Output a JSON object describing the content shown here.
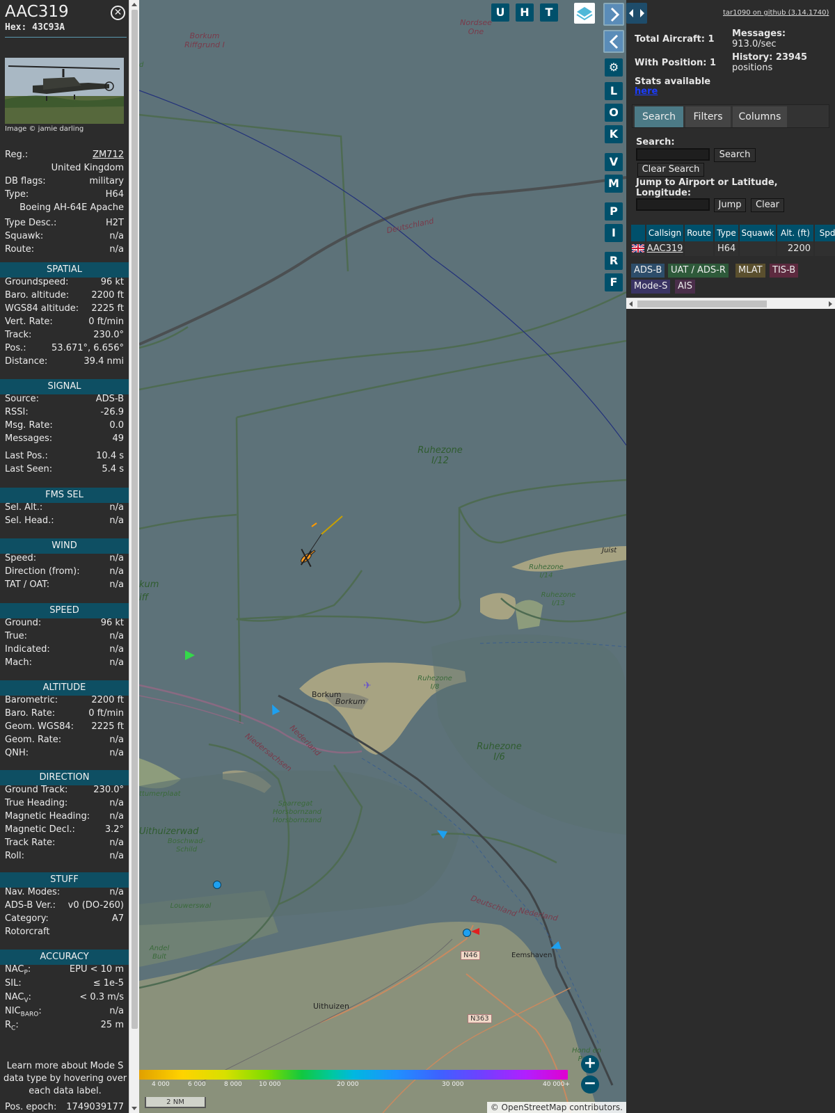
{
  "aircraft": {
    "callsign": "AAC319",
    "hex_label": "Hex: 43C93A",
    "photo_credit": "Image © jamie darling",
    "rows_top": [
      {
        "k": "Reg.:",
        "v": "ZM712"
      },
      {
        "k": "",
        "v": "United Kingdom"
      },
      {
        "k": "DB flags:",
        "v": "military"
      },
      {
        "k": "Type:",
        "v": "H64"
      },
      {
        "k": "",
        "v": "Boeing AH-64E Apache"
      },
      {
        "k": "Type Desc.:",
        "v": "H2T"
      },
      {
        "k": "Squawk:",
        "v": "n/a"
      },
      {
        "k": "Route:",
        "v": "n/a"
      }
    ]
  },
  "sections": {
    "spatial": {
      "title": "SPATIAL",
      "rows": [
        {
          "k": "Groundspeed:",
          "v": "96 kt"
        },
        {
          "k": "Baro. altitude:",
          "v": "2200 ft"
        },
        {
          "k": "WGS84 altitude:",
          "v": "2225 ft"
        },
        {
          "k": "Vert. Rate:",
          "v": "0 ft/min"
        },
        {
          "k": "Track:",
          "v": "230.0°"
        },
        {
          "k": "Pos.:",
          "v": "53.671°, 6.656°"
        },
        {
          "k": "Distance:",
          "v": "39.4 nmi"
        }
      ]
    },
    "signal": {
      "title": "SIGNAL",
      "rows": [
        {
          "k": "Source:",
          "v": "ADS-B"
        },
        {
          "k": "RSSI:",
          "v": "-26.9"
        },
        {
          "k": "Msg. Rate:",
          "v": "0.0"
        },
        {
          "k": "Messages:",
          "v": "49"
        },
        {
          "k": "Last Pos.:",
          "v": "10.4 s"
        },
        {
          "k": "Last Seen:",
          "v": "5.4 s"
        }
      ]
    },
    "fms": {
      "title": "FMS SEL",
      "rows": [
        {
          "k": "Sel. Alt.:",
          "v": "n/a"
        },
        {
          "k": "Sel. Head.:",
          "v": "n/a"
        }
      ]
    },
    "wind": {
      "title": "WIND",
      "rows": [
        {
          "k": "Speed:",
          "v": "n/a"
        },
        {
          "k": "Direction (from):",
          "v": "n/a"
        },
        {
          "k": "TAT / OAT:",
          "v": "n/a"
        }
      ]
    },
    "speed": {
      "title": "SPEED",
      "rows": [
        {
          "k": "Ground:",
          "v": "96 kt"
        },
        {
          "k": "True:",
          "v": "n/a"
        },
        {
          "k": "Indicated:",
          "v": "n/a"
        },
        {
          "k": "Mach:",
          "v": "n/a"
        }
      ]
    },
    "altitude": {
      "title": "ALTITUDE",
      "rows": [
        {
          "k": "Barometric:",
          "v": "2200 ft"
        },
        {
          "k": "Baro. Rate:",
          "v": "0 ft/min"
        },
        {
          "k": "Geom. WGS84:",
          "v": "2225 ft"
        },
        {
          "k": "Geom. Rate:",
          "v": "n/a"
        },
        {
          "k": "QNH:",
          "v": "n/a"
        }
      ]
    },
    "direction": {
      "title": "DIRECTION",
      "rows": [
        {
          "k": "Ground Track:",
          "v": "230.0°"
        },
        {
          "k": "True Heading:",
          "v": "n/a"
        },
        {
          "k": "Magnetic Heading:",
          "v": "n/a"
        },
        {
          "k": "Magnetic Decl.:",
          "v": "3.2°"
        },
        {
          "k": "Track Rate:",
          "v": "n/a"
        },
        {
          "k": "Roll:",
          "v": "n/a"
        }
      ]
    },
    "stuff": {
      "title": "STUFF",
      "rows": [
        {
          "k": "Nav. Modes:",
          "v": "n/a"
        },
        {
          "k": "ADS-B Ver.:",
          "v": "v0 (DO-260)"
        },
        {
          "k": "Category:",
          "v": "A7"
        },
        {
          "k": "Rotorcraft",
          "v": ""
        }
      ]
    },
    "accuracy": {
      "title": "ACCURACY",
      "rows": [
        {
          "k": "NAC",
          "sub": "P",
          "v": "EPU < 10 m"
        },
        {
          "k": "SIL:",
          "v": "≤ 1e-5"
        },
        {
          "k": "NAC",
          "sub": "V",
          "v": "< 0.3 m/s"
        },
        {
          "k": "NIC",
          "sub": "BARO",
          "v": "n/a"
        },
        {
          "k": "R",
          "sub": "C",
          "v": "25 m"
        }
      ]
    },
    "learn_more": "Learn more about Mode S data type by hovering over each data label.",
    "pos_epoch": {
      "k": "Pos. epoch:",
      "v": "1749039177"
    }
  },
  "map": {
    "top_buttons": [
      "U",
      "H",
      "T"
    ],
    "side_buttons": [
      "L",
      "O",
      "K",
      "V",
      "M",
      "P",
      "I",
      "R",
      "F"
    ],
    "labels": {
      "borkum_riff": "Borkum Riffgrund I",
      "nordsee": "Nordsee One",
      "ruhezone_i12": "Ruhezone I/12",
      "ruhezone_i14": "Ruhezone I/14",
      "ruhezone_i13": "Ruhezone I/13",
      "ruhezone_i6": "Ruhezone I/6",
      "ruhezone_i8": "Ruhezone I/8",
      "juist": "Juist",
      "borkum_town": "Borkum",
      "borkum_island": "Borkum",
      "deutschland_top": "Deutschland",
      "deutschland_bottom": "Deutschland",
      "nederland": "Nederland",
      "nederland2": "Nederland",
      "niedersachsen": "Niedersachsen",
      "sparregat": "Sparregat Horsbornzand Horsbornzand",
      "uithuizerwad": "Uithuizerwad",
      "boschwad": "Boschwad-Schild",
      "louwerswal": "Louwerswal",
      "andel": "Andel Bult",
      "uithuizen": "Uithuizen",
      "eemshaven": "Eemshaven",
      "hond": "Hond en Paap",
      "umerplaat": "ttumerplaat",
      "kum": "kum",
      "iff": "iff",
      "d": "d"
    },
    "roads": [
      "N46",
      "N363"
    ],
    "altitude_scale": [
      "4 000",
      "6 000",
      "8 000",
      "10 000",
      "20 000",
      "30 000",
      "40 000+"
    ],
    "scale_label": "2 NM",
    "attribution": "© OpenStreetMap contributors."
  },
  "side": {
    "version_link": "tar1090 on github (3.14.1740)",
    "total_aircraft": "Total Aircraft: 1",
    "with_position": "With Position: 1",
    "messages_label": "Messages:",
    "messages_value": "913.0/sec",
    "history_label": "History: 23945",
    "history_value": "positions",
    "stats_label": "Stats available",
    "stats_link": "here",
    "tabs": [
      "Search",
      "Filters",
      "Columns"
    ],
    "search_label": "Search:",
    "search_button": "Search",
    "clear_search_button": "Clear Search",
    "jump_label": "Jump to Airport or Latitude, Longitude:",
    "jump_button": "Jump",
    "clear_button": "Clear",
    "table_headers": [
      "Callsign",
      "Route",
      "Type",
      "Squawk",
      "Alt. (ft)",
      "Spd."
    ],
    "table_row": {
      "callsign": "AAC319",
      "route": "",
      "type": "H64",
      "squawk": "",
      "alt": "2200"
    },
    "sources": [
      {
        "label": "ADS-B",
        "color": "#2d4d6a"
      },
      {
        "label": "UAT / ADS-R",
        "color": "#2e5a3a"
      },
      {
        "label": "MLAT",
        "color": "#5a4f2e"
      },
      {
        "label": "TIS-B",
        "color": "#5d2a3f"
      },
      {
        "label": "Mode-S",
        "color": "#3a3464"
      },
      {
        "label": "AIS",
        "color": "#4a2e4a"
      }
    ]
  }
}
